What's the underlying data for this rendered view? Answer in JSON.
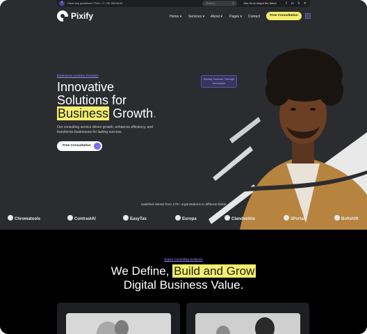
{
  "topbar": {
    "question_text": "Have any questions? Free: +1 730 263 8444",
    "search_placeholder": "Search...",
    "social_label": "Join Us to shape the future",
    "social_icons": [
      "facebook-icon",
      "linkedin-icon",
      "x-icon",
      "pinterest-icon"
    ]
  },
  "brand": {
    "name": "Pixify"
  },
  "nav": {
    "items": [
      "Home",
      "Services",
      "About",
      "Pages",
      "Contact"
    ],
    "cta": "Free Consultation"
  },
  "hero": {
    "eyebrow": "Experience Creative Freedom",
    "headline_line1": "Innovative",
    "headline_line2": "Solutions for",
    "headline_highlight": "Business",
    "headline_rest": "Growth",
    "description": "Our consulting service drives growth, enhances efficiency, and transforms businesses for lasting success.",
    "cta": "Free Consultation",
    "badge": "Driving Success Through Innovation"
  },
  "clients": {
    "label": "Satisfied clients from 170+ organisations in different fields",
    "logos": [
      "Chromatools",
      "ContrastAI",
      "EasyTax",
      "Europa",
      "Clandestine",
      "3Portals",
      "Boltshift"
    ]
  },
  "section2": {
    "eyebrow": "Expert Consulting Solutions",
    "title_pre": "We Define,",
    "title_highlight": "Build and Grow",
    "title_line2": "Digital Business Value."
  },
  "colors": {
    "accent": "#f4ef6d",
    "purple": "#8a7cff",
    "hero_bg": "#2b2c2f",
    "section_bg": "#000000"
  }
}
